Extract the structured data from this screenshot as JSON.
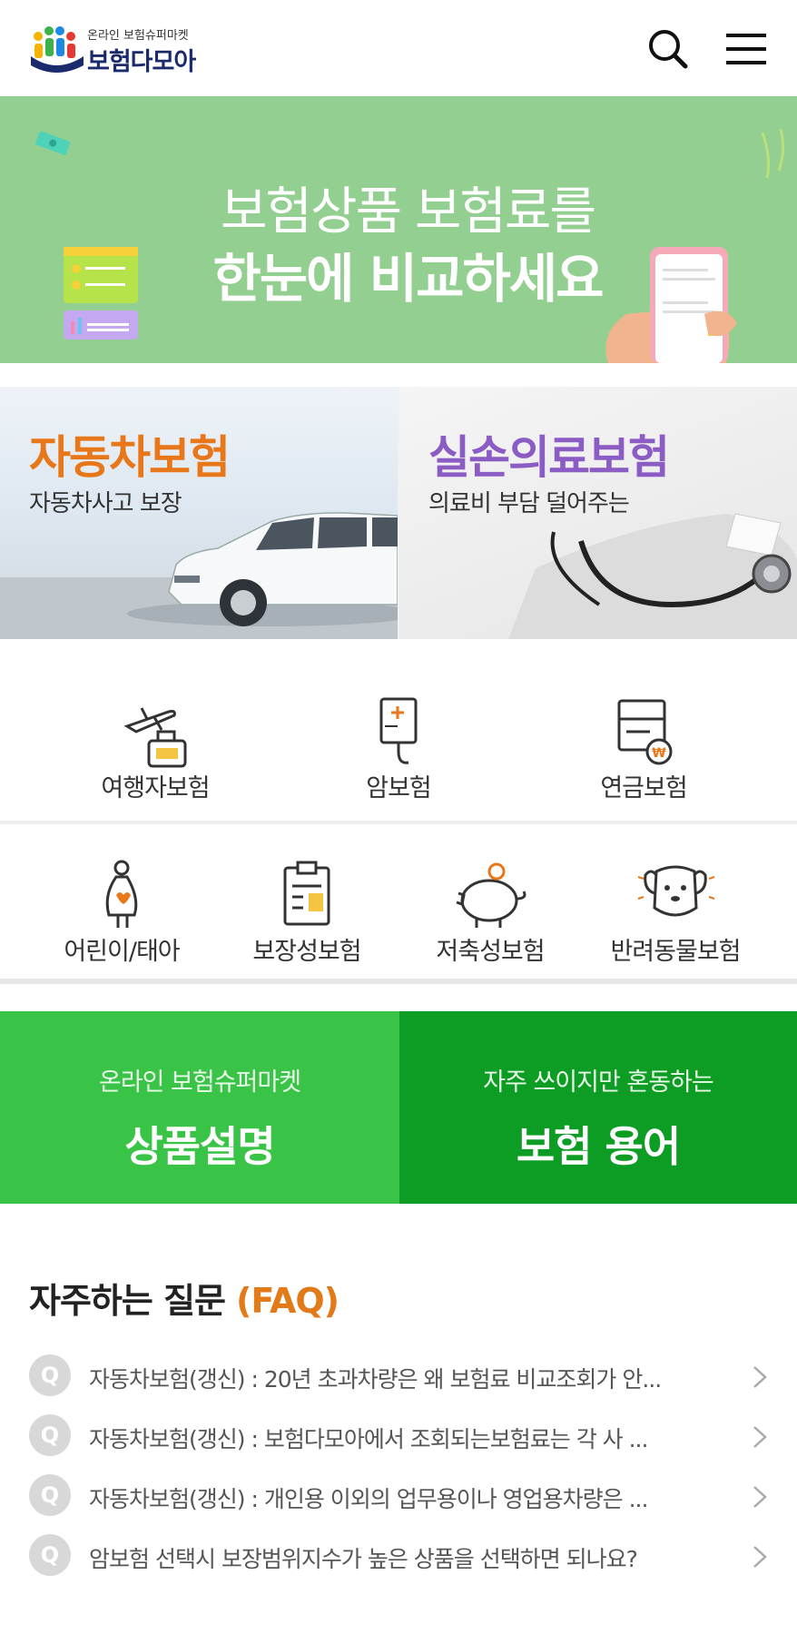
{
  "header": {
    "logo_tagline": "온라인 보험슈퍼마켓",
    "logo_name": "보험다모아",
    "search_icon": "search-icon",
    "menu_icon": "hamburger-menu-icon"
  },
  "banner": {
    "line1": "보험상품 보험료를",
    "line2": "한눈에 비교하세요",
    "colors": {
      "background": "#93cf91"
    }
  },
  "featured": [
    {
      "title": "자동차보험",
      "subtitle": "자동차사고 보장",
      "color": "#e8771a"
    },
    {
      "title": "실손의료보험",
      "subtitle": "의료비 부담 덜어주는",
      "color": "#8a5cc4"
    }
  ],
  "categories_row1": [
    {
      "label": "여행자보험",
      "icon": "travel-icon"
    },
    {
      "label": "암보험",
      "icon": "iv-drip-icon"
    },
    {
      "label": "연금보험",
      "icon": "pension-document-icon"
    }
  ],
  "categories_row2": [
    {
      "label": "어린이/태아",
      "icon": "pregnant-mother-icon"
    },
    {
      "label": "보장성보험",
      "icon": "clipboard-icon"
    },
    {
      "label": "저축성보험",
      "icon": "piggy-bank-icon"
    },
    {
      "label": "반려동물보험",
      "icon": "dog-icon"
    }
  ],
  "info_buttons": [
    {
      "small": "온라인 보험슈퍼마켓",
      "big": "상품설명",
      "color": "#39c448"
    },
    {
      "small": "자주 쓰이지만 혼동하는",
      "big": "보험 용어",
      "color": "#0d9c24"
    }
  ],
  "faq": {
    "title": "자주하는 질문",
    "title_accent": "(FAQ)",
    "badge": "Q",
    "items": [
      "자동차보험(갱신) : 20년 초과차량은 왜 보험료 비교조회가 안...",
      "자동차보험(갱신) : 보험다모아에서 조회되는보험료는 각 사 ...",
      "자동차보험(갱신) : 개인용 이외의 업무용이나 영업용차량은 ...",
      "암보험 선택시 보장범위지수가 높은 상품을 선택하면 되나요?"
    ]
  }
}
